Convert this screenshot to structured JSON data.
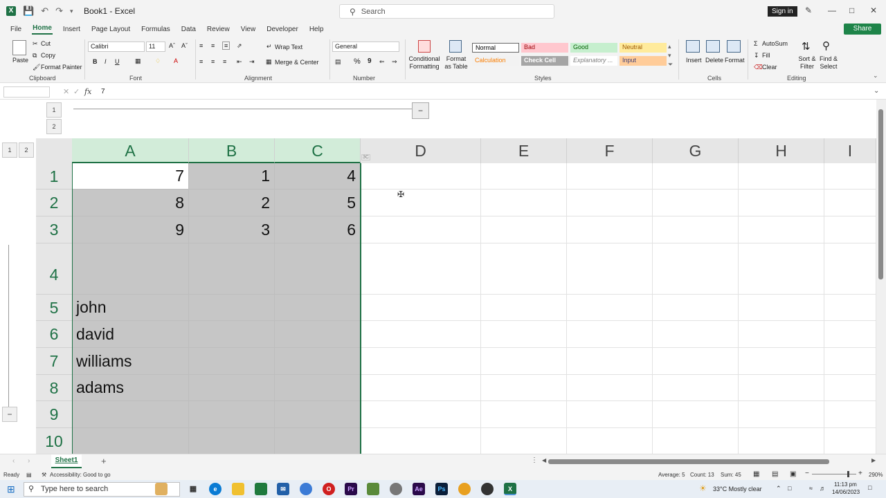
{
  "window": {
    "title": "Book1 - Excel",
    "search_placeholder": "Search",
    "sign_in": "Sign in",
    "share": "Share"
  },
  "tabs": [
    "File",
    "Home",
    "Insert",
    "Page Layout",
    "Formulas",
    "Data",
    "Review",
    "View",
    "Developer",
    "Help"
  ],
  "active_tab": "Home",
  "ribbon": {
    "clipboard": {
      "label": "Clipboard",
      "paste": "Paste",
      "cut": "Cut",
      "copy": "Copy",
      "format_painter": "Format Painter"
    },
    "font": {
      "label": "Font",
      "name": "Calibri",
      "size": "11",
      "bold": "B",
      "italic": "I",
      "underline": "U"
    },
    "alignment": {
      "label": "Alignment",
      "wrap_text": "Wrap Text",
      "merge_center": "Merge & Center"
    },
    "number": {
      "label": "Number",
      "format": "General",
      "percent": "%",
      "comma": "9"
    },
    "styles": {
      "label": "Styles",
      "conditional": "Conditional Formatting",
      "format_table": "Format as Table",
      "cells": [
        {
          "name": "Normal",
          "bg": "#ffffff",
          "color": "#000000"
        },
        {
          "name": "Bad",
          "bg": "#ffc7ce",
          "color": "#9c0006"
        },
        {
          "name": "Good",
          "bg": "#c6efce",
          "color": "#006100"
        },
        {
          "name": "Neutral",
          "bg": "#ffeb9c",
          "color": "#9c5700"
        },
        {
          "name": "Calculation",
          "bg": "#f2f2f2",
          "color": "#fa7d00"
        },
        {
          "name": "Check Cell",
          "bg": "#a5a5a5",
          "color": "#ffffff"
        },
        {
          "name": "Explanatory ...",
          "bg": "#ffffff",
          "color": "#7f7f7f"
        },
        {
          "name": "Input",
          "bg": "#ffcc99",
          "color": "#3f3f76"
        }
      ]
    },
    "cells": {
      "label": "Cells",
      "insert": "Insert",
      "delete": "Delete",
      "format": "Format"
    },
    "editing": {
      "label": "Editing",
      "autosum": "AutoSum",
      "fill": "Fill",
      "clear": "Clear",
      "sort_filter": "Sort & Filter",
      "find_select": "Find & Select"
    }
  },
  "formula_bar": {
    "fx": "fx",
    "value": "7"
  },
  "outline": {
    "levels": [
      "1",
      "2"
    ],
    "row_levels": [
      "1",
      "2"
    ],
    "collapse": "−"
  },
  "grid": {
    "columns": [
      "A",
      "B",
      "C",
      "D",
      "E",
      "F",
      "G",
      "H",
      "I"
    ],
    "rows": [
      "1",
      "2",
      "3",
      "4",
      "5",
      "6",
      "7",
      "8",
      "9",
      "10"
    ],
    "cells": {
      "A1": "7",
      "B1": "1",
      "C1": "4",
      "A2": "8",
      "B2": "2",
      "C2": "5",
      "A3": "9",
      "B3": "3",
      "C3": "6",
      "A5": "john",
      "A6": "david",
      "A7": "williams",
      "A8": "adams"
    },
    "selection_tag": "3C"
  },
  "sheet": {
    "name": "Sheet1",
    "add": "+"
  },
  "status": {
    "ready": "Ready",
    "accessibility": "Accessibility: Good to go",
    "average": "Average: 5",
    "count": "Count: 13",
    "sum": "Sum: 45",
    "zoom": "290%"
  },
  "taskbar": {
    "search": "Type here to search",
    "weather": "33°C  Mostly clear",
    "time": "11:13 pm",
    "date": "14/06/2023"
  }
}
